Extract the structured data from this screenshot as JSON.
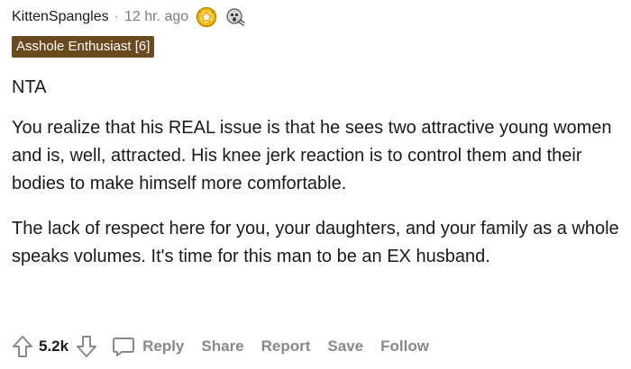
{
  "comment": {
    "username": "KittenSpangles",
    "separator": "·",
    "time_ago": "12 hr. ago",
    "awards": [
      "gold-star-award-icon",
      "gasp-award-icon"
    ],
    "flair": "Asshole Enthusiast [6]",
    "paragraphs": [
      "NTA",
      "You realize that his REAL issue is that he sees two attractive young women and is, well, attracted. His knee jerk reaction is to control them and their bodies to make himself more comfortable.",
      "The lack of respect here for you, your daughters, and your family as a whole speaks volumes. It's time for this man to be an EX husband."
    ]
  },
  "actions": {
    "score": "5.2k",
    "reply": "Reply",
    "share": "Share",
    "report": "Report",
    "save": "Save",
    "follow": "Follow"
  },
  "colors": {
    "flair_bg": "#6b4a20",
    "flair_text": "#ffffff",
    "meta_gray": "#7c7c7c",
    "action_gray": "#878a8c",
    "award_gold": "#f5b400"
  }
}
